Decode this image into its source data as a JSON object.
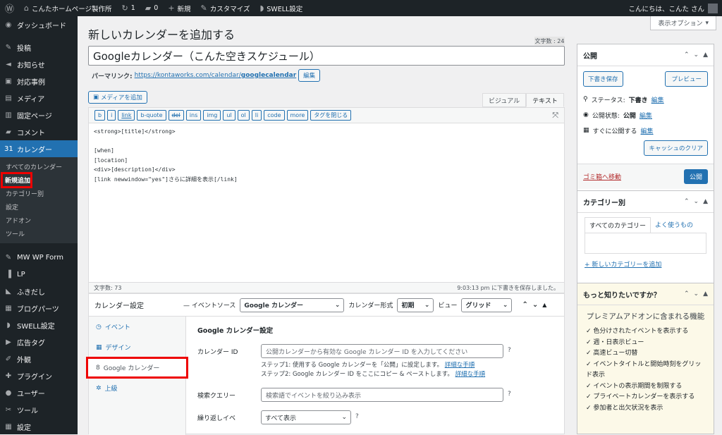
{
  "admin_bar": {
    "site_name": "こんたホームページ製作所",
    "updates": "1",
    "comments": "0",
    "new": "新規",
    "customize": "カスタマイズ",
    "swell": "SWELL設定",
    "greeting": "こんにちは、こんた さん"
  },
  "sidebar": {
    "items": [
      {
        "icon": "dashboard-icon",
        "glyph": "◉",
        "label": "ダッシュボード"
      },
      {
        "icon": "pin-icon",
        "glyph": "✎",
        "label": "投稿"
      },
      {
        "icon": "megaphone-icon",
        "glyph": "◄",
        "label": "お知らせ"
      },
      {
        "icon": "folder-icon",
        "glyph": "▣",
        "label": "対応事例"
      },
      {
        "icon": "media-icon",
        "glyph": "▤",
        "label": "メディア"
      },
      {
        "icon": "page-icon",
        "glyph": "▥",
        "label": "固定ページ"
      },
      {
        "icon": "comment-icon",
        "glyph": "▰",
        "label": "コメント"
      },
      {
        "icon": "calendar-icon",
        "glyph": "31",
        "label": "カレンダー"
      }
    ],
    "calendar_sub": [
      "すべてのカレンダー",
      "新規追加",
      "カテゴリー別",
      "設定",
      "アドオン",
      "ツール"
    ],
    "items2": [
      {
        "icon": "form-icon",
        "glyph": "✎",
        "label": "MW WP Form"
      },
      {
        "icon": "lp-icon",
        "glyph": "▐",
        "label": "LP"
      },
      {
        "icon": "bubble-icon",
        "glyph": "◣",
        "label": "ふきだし"
      },
      {
        "icon": "blocks-icon",
        "glyph": "▦",
        "label": "ブログパーツ"
      },
      {
        "icon": "swell-icon",
        "glyph": "◗",
        "label": "SWELL設定"
      },
      {
        "icon": "ad-icon",
        "glyph": "▶",
        "label": "広告タグ"
      },
      {
        "icon": "brush-icon",
        "glyph": "✐",
        "label": "外観"
      },
      {
        "icon": "plugin-icon",
        "glyph": "✚",
        "label": "プラグイン"
      },
      {
        "icon": "user-icon",
        "glyph": "●",
        "label": "ユーザー"
      },
      {
        "icon": "wrench-icon",
        "glyph": "✂",
        "label": "ツール"
      },
      {
        "icon": "settings-icon",
        "glyph": "▦",
        "label": "設定"
      }
    ]
  },
  "page": {
    "heading": "新しいカレンダーを追加する",
    "screen_options": "表示オプション",
    "word_count_badge": "文字数 : 24",
    "title_value": "Googleカレンダー（こんた空きスケジュール）",
    "permalink_label": "パーマリンク:",
    "permalink_base": "https://kontaworks.com/calendar/",
    "permalink_slug": "googlecalendar",
    "edit": "編集",
    "add_media": "メディアを追加",
    "tab_visual": "ビジュアル",
    "tab_text": "テキスト",
    "quicktags": [
      "b",
      "i",
      "link",
      "b-quote",
      "del",
      "ins",
      "img",
      "ul",
      "ol",
      "li",
      "code",
      "more",
      "タグを閉じる"
    ],
    "content_lines": [
      "<strong>[title]</strong>",
      "",
      "[when]",
      "[location]",
      "<div>[description]</div>",
      "[link newwindow=\"yes\"]さらに詳細を表示[/link]"
    ],
    "word_count": "文字数: 73",
    "autosave": "9:03:13 pm に下書きを保存しました。"
  },
  "calendar_settings": {
    "title": "カレンダー設定",
    "event_source_label": "— イベントソース",
    "event_source": "Google カレンダー",
    "format_label": "カレンダー形式",
    "format": "初期",
    "view_label": "ビュー",
    "view": "グリッド",
    "nav": [
      {
        "icon": "clock-icon",
        "glyph": "◷",
        "label": "イベント"
      },
      {
        "icon": "calendar-small-icon",
        "glyph": "▦",
        "label": "デザイン"
      },
      {
        "icon": "google-icon",
        "glyph": "8",
        "label": "Google カレンダー"
      },
      {
        "icon": "cogs-icon",
        "glyph": "✲",
        "label": "上級"
      }
    ],
    "section_title": "Google カレンダー設定",
    "calendar_id_label": "カレンダー ID",
    "calendar_id_placeholder": "公開カレンダーから有効な Google カレンダー ID を入力してください",
    "step1": "ステップ1: 使用する Google カレンダーを「公開」に設定します。",
    "step2": "ステップ2: Google カレンダー ID をここにコピー & ペーストします。",
    "details_link": "詳細な手順",
    "search_label": "検索クエリー",
    "search_placeholder": "検索語でイベントを絞り込み表示",
    "recurring_label": "繰り返しイベ",
    "recurring_value": "すべて表示"
  },
  "publish": {
    "title": "公開",
    "save_draft": "下書き保存",
    "preview": "プレビュー",
    "status_label": "ステータス:",
    "status_value": "下書き",
    "visibility_label": "公開状態:",
    "visibility_value": "公開",
    "schedule": "すぐに公開する",
    "edit": "編集",
    "purge_cache": "キャッシュのクリア",
    "trash": "ゴミ箱へ移動",
    "publish_btn": "公開"
  },
  "categories": {
    "title": "カテゴリー別",
    "tab_all": "すべてのカテゴリー",
    "tab_popular": "よく使うもの",
    "add_new": "+ 新しいカテゴリーを追加"
  },
  "promo": {
    "title": "もっと知りたいですか？",
    "headline": "プレミアムアドオンに含まれる機能",
    "features": [
      "色分けされたイベントを表示する",
      "週・日表示ビュー",
      "高速ビュー切替",
      "イベントタイトルと開始時刻をグリッド表示",
      "イベントの表示期間を制限する",
      "プライベートカレンダーを表示する",
      "参加者と出欠状況を表示"
    ]
  }
}
